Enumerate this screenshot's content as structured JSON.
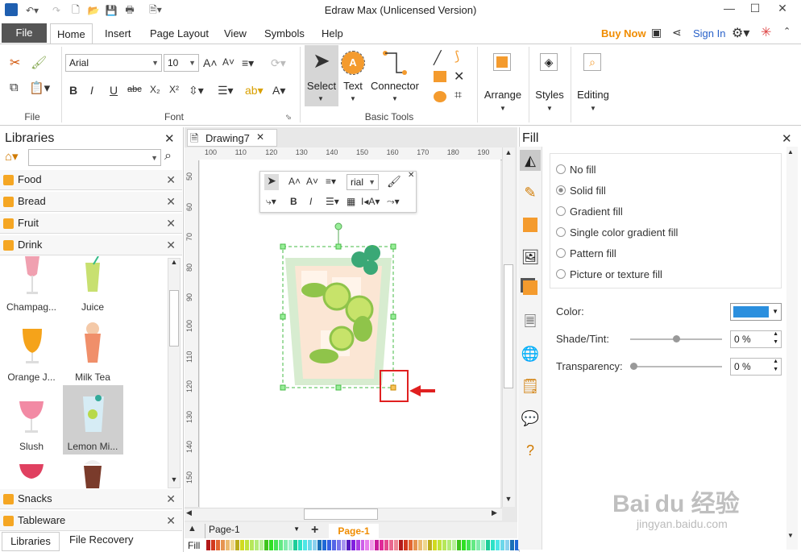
{
  "app": {
    "title": "Edraw Max (Unlicensed Version)"
  },
  "menu": {
    "file": "File",
    "tabs": [
      "Home",
      "Insert",
      "Page Layout",
      "View",
      "Symbols",
      "Help"
    ],
    "buy_now": "Buy Now",
    "sign_in": "Sign In"
  },
  "ribbon": {
    "groups": {
      "file": "File",
      "font": "Font",
      "basic_tools": "Basic Tools"
    },
    "font_name": "Arial",
    "font_size": "10",
    "tools": {
      "select": "Select",
      "text": "Text",
      "connector": "Connector",
      "arrange": "Arrange",
      "styles": "Styles",
      "editing": "Editing"
    }
  },
  "libraries": {
    "title": "Libraries",
    "categories": [
      "Food",
      "Bread",
      "Fruit",
      "Drink",
      "Snacks",
      "Tableware"
    ],
    "drink_items": [
      "Champag...",
      "Juice",
      "Orange J...",
      "Milk Tea",
      "Slush",
      "Lemon Mi..."
    ],
    "bottom_tabs": [
      "Libraries",
      "File Recovery"
    ]
  },
  "canvas": {
    "tab": "Drawing7",
    "ruler_h": [
      "100",
      "110",
      "120",
      "130",
      "140",
      "150",
      "160",
      "170",
      "180",
      "190"
    ],
    "ruler_v": [
      "50",
      "60",
      "70",
      "80",
      "90",
      "100",
      "110",
      "120",
      "130",
      "140",
      "150"
    ],
    "float_font": "rial",
    "page_selector": "Page-1",
    "page_tab": "Page-1",
    "bottom_label": "Fill"
  },
  "fill": {
    "title": "Fill",
    "options": [
      "No fill",
      "Solid fill",
      "Gradient fill",
      "Single color gradient fill",
      "Pattern fill",
      "Picture or texture fill"
    ],
    "selected": "Solid fill",
    "color_label": "Color:",
    "shade_label": "Shade/Tint:",
    "shade_value": "0 %",
    "transparency_label": "Transparency:",
    "transparency_value": "0 %",
    "color_value": "#2b8fde"
  },
  "watermark": {
    "text": "Bai du 经验",
    "url": "jingyan.baidu.com"
  }
}
